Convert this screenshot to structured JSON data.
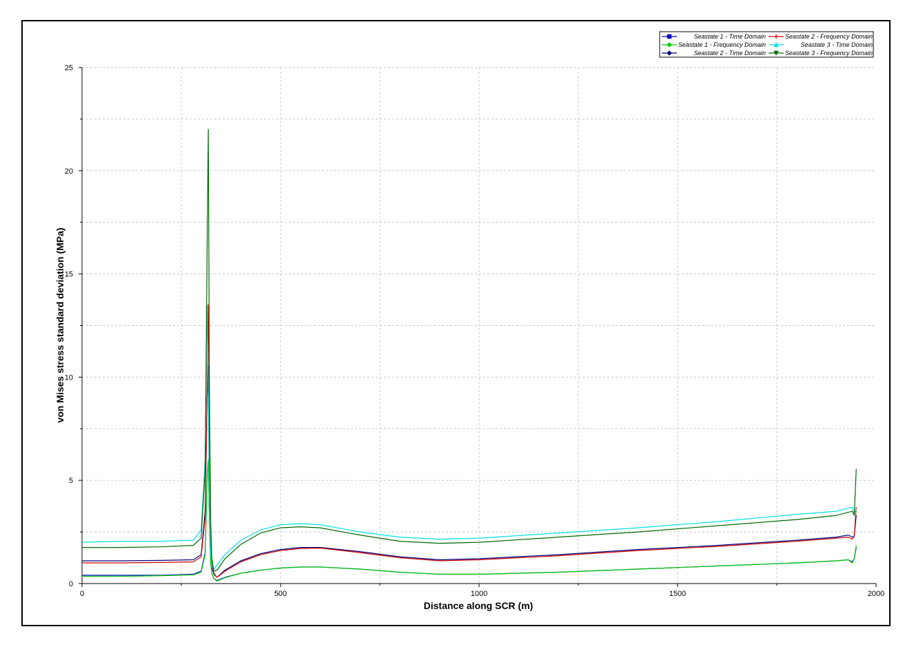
{
  "chart_data": {
    "type": "line",
    "title": "",
    "xlabel": "Distance along SCR (m)",
    "ylabel": "von Mises stress standard deviation (MPa)",
    "xlim": [
      0,
      2000
    ],
    "ylim": [
      0,
      25
    ],
    "x_ticks": [
      0,
      500,
      1000,
      1500,
      2000
    ],
    "y_ticks": [
      0,
      5,
      10,
      15,
      20,
      25
    ],
    "grid": true,
    "legend_position": "top-right",
    "x": [
      0,
      100,
      200,
      280,
      300,
      310,
      315,
      318,
      321,
      324,
      327,
      332,
      340,
      360,
      400,
      450,
      500,
      550,
      600,
      700,
      800,
      900,
      1000,
      1200,
      1400,
      1600,
      1800,
      1900,
      1930,
      1940,
      1945,
      1950
    ],
    "series": [
      {
        "name": "Seastate 1 - Time Domain",
        "color": "#0000cc",
        "marker": "square",
        "values": [
          0.4,
          0.4,
          0.4,
          0.45,
          0.6,
          1.5,
          5.0,
          6.0,
          2.8,
          1.0,
          0.5,
          0.25,
          0.15,
          0.3,
          0.5,
          0.65,
          0.75,
          0.8,
          0.8,
          0.7,
          0.55,
          0.45,
          0.45,
          0.55,
          0.7,
          0.85,
          1.0,
          1.1,
          1.15,
          1.05,
          1.2,
          1.75
        ]
      },
      {
        "name": "Seastate 1 - Frequency Domain",
        "color": "#00cc00",
        "marker": "diamond",
        "values": [
          0.35,
          0.35,
          0.38,
          0.42,
          0.55,
          1.4,
          5.0,
          6.0,
          2.8,
          1.0,
          0.5,
          0.25,
          0.12,
          0.28,
          0.5,
          0.65,
          0.75,
          0.8,
          0.8,
          0.7,
          0.55,
          0.45,
          0.45,
          0.55,
          0.7,
          0.85,
          1.0,
          1.1,
          1.15,
          1.0,
          1.2,
          1.85
        ]
      },
      {
        "name": "Seastate 2 - Time Domain",
        "color": "#000080",
        "marker": "diamond",
        "values": [
          1.1,
          1.1,
          1.12,
          1.15,
          1.4,
          3.5,
          9.0,
          10.5,
          5.0,
          1.8,
          0.8,
          0.45,
          0.3,
          0.65,
          1.1,
          1.45,
          1.65,
          1.75,
          1.75,
          1.55,
          1.3,
          1.15,
          1.2,
          1.4,
          1.65,
          1.85,
          2.1,
          2.25,
          2.35,
          2.25,
          2.3,
          3.3
        ]
      },
      {
        "name": "Seastate 2 - Frequency Domain",
        "color": "#cc0000",
        "marker": "plus",
        "values": [
          1.0,
          1.0,
          1.02,
          1.05,
          1.3,
          3.2,
          9.0,
          13.5,
          6.5,
          2.2,
          0.9,
          0.5,
          0.3,
          0.6,
          1.05,
          1.4,
          1.6,
          1.7,
          1.72,
          1.5,
          1.25,
          1.1,
          1.15,
          1.35,
          1.6,
          1.8,
          2.05,
          2.2,
          2.25,
          2.15,
          2.3,
          3.7
        ]
      },
      {
        "name": "Seastate 3 - Time Domain",
        "color": "#00e0e0",
        "marker": "triangle-up",
        "values": [
          2.0,
          2.05,
          2.05,
          2.1,
          2.6,
          6.0,
          13.5,
          9.0,
          3.5,
          1.5,
          0.8,
          0.7,
          0.9,
          1.4,
          2.1,
          2.6,
          2.85,
          2.9,
          2.85,
          2.5,
          2.25,
          2.15,
          2.2,
          2.45,
          2.7,
          3.0,
          3.35,
          3.5,
          3.65,
          3.7,
          3.4,
          3.6
        ]
      },
      {
        "name": "Seastate 3 - Frequency Domain",
        "color": "#006600",
        "marker": "triangle-down",
        "values": [
          1.75,
          1.75,
          1.78,
          1.85,
          2.2,
          5.5,
          16.0,
          22.0,
          9.0,
          3.0,
          1.2,
          0.6,
          0.65,
          1.2,
          1.9,
          2.45,
          2.7,
          2.75,
          2.7,
          2.35,
          2.05,
          1.95,
          2.0,
          2.25,
          2.5,
          2.8,
          3.1,
          3.3,
          3.45,
          3.5,
          3.3,
          5.55
        ]
      }
    ]
  }
}
